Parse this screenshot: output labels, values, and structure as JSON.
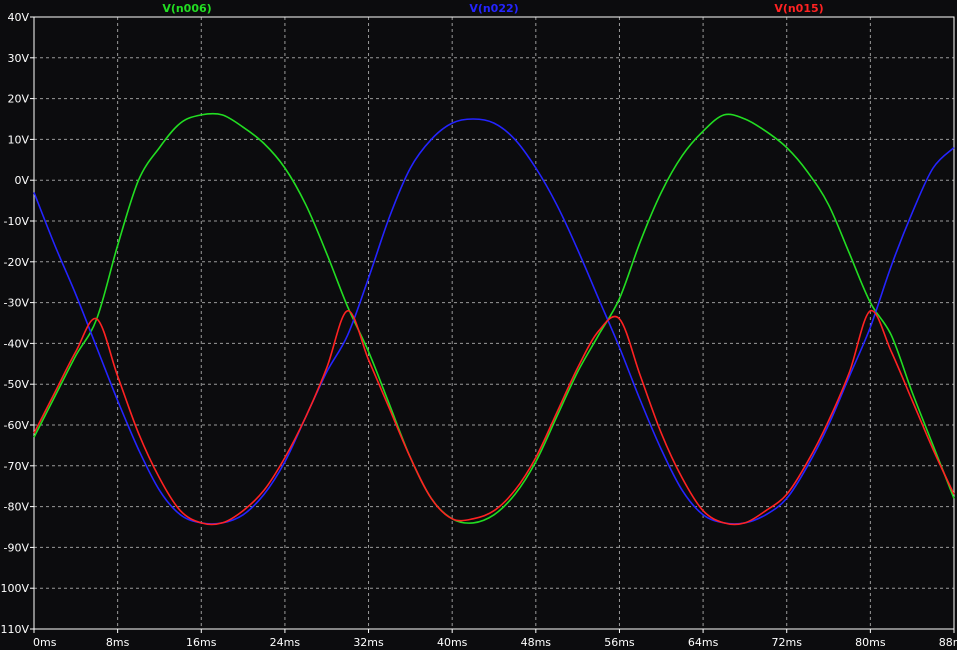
{
  "chart_data": {
    "type": "line",
    "xlabel": "",
    "ylabel": "",
    "xlim": [
      0,
      88
    ],
    "ylim": [
      -110,
      40
    ],
    "x_ticks": [
      "0ms",
      "8ms",
      "16ms",
      "24ms",
      "32ms",
      "40ms",
      "48ms",
      "56ms",
      "64ms",
      "72ms",
      "80ms",
      "88ms"
    ],
    "y_ticks": [
      "40V",
      "30V",
      "20V",
      "10V",
      "0V",
      "-10V",
      "-20V",
      "-30V",
      "-40V",
      "-50V",
      "-60V",
      "-70V",
      "-80V",
      "-90V",
      "-100V",
      "-110V"
    ],
    "grid": true,
    "legend_position": "top",
    "colors": {
      "background": "#0c0c0e",
      "grid": "#9a9a9a",
      "text": "#ffffff"
    },
    "series": [
      {
        "name": "V(n006)",
        "color": "#22dd22",
        "x": [
          0,
          2,
          4,
          6,
          8,
          10,
          12,
          14,
          16,
          18,
          20,
          22,
          24,
          26,
          28,
          30,
          32,
          34,
          36,
          38,
          40,
          42,
          44,
          46,
          48,
          50,
          52,
          54,
          56,
          58,
          60,
          62,
          64,
          66,
          68,
          70,
          72,
          74,
          76,
          78,
          80,
          82,
          84,
          86,
          88
        ],
        "y": [
          -63,
          -53,
          -43,
          -34,
          -16,
          0,
          8,
          14,
          16,
          16,
          13,
          9,
          3,
          -6,
          -18,
          -31,
          -42,
          -55,
          -68,
          -78,
          -83,
          -84,
          -82,
          -77,
          -69,
          -58,
          -47,
          -38,
          -29,
          -15,
          -3,
          6,
          12,
          16,
          15,
          12,
          8,
          2,
          -6,
          -18,
          -30,
          -38,
          -52,
          -65,
          -78
        ]
      },
      {
        "name": "V(n022)",
        "color": "#2424ff",
        "x": [
          0,
          2,
          4,
          6,
          8,
          10,
          12,
          14,
          16,
          18,
          20,
          22,
          24,
          26,
          28,
          30,
          32,
          34,
          36,
          38,
          40,
          42,
          44,
          46,
          48,
          50,
          52,
          54,
          56,
          58,
          60,
          62,
          64,
          66,
          68,
          70,
          72,
          74,
          76,
          78,
          80,
          82,
          84,
          86,
          88
        ],
        "y": [
          -3,
          -16,
          -28,
          -41,
          -54,
          -66,
          -76,
          -82,
          -84,
          -84,
          -82,
          -77,
          -69,
          -58,
          -47,
          -38,
          -24,
          -9,
          3,
          10,
          14,
          15,
          14,
          10,
          3,
          -6,
          -17,
          -29,
          -41,
          -54,
          -66,
          -76,
          -82,
          -84,
          -84,
          -82,
          -78,
          -70,
          -60,
          -48,
          -36,
          -21,
          -8,
          3,
          8
        ]
      },
      {
        "name": "V(n015)",
        "color": "#ff2222",
        "x": [
          0,
          2,
          4,
          6,
          8,
          10,
          12,
          14,
          16,
          18,
          20,
          22,
          24,
          26,
          28,
          30,
          32,
          34,
          36,
          38,
          40,
          42,
          44,
          46,
          48,
          50,
          52,
          54,
          56,
          58,
          60,
          62,
          64,
          66,
          68,
          70,
          72,
          74,
          76,
          78,
          80,
          82,
          84,
          86,
          88
        ],
        "y": [
          -62,
          -52,
          -42,
          -34,
          -48,
          -62,
          -73,
          -81,
          -84,
          -84,
          -81,
          -76,
          -68,
          -58,
          -46,
          -32,
          -44,
          -56,
          -68,
          -78,
          -83,
          -83,
          -81,
          -76,
          -68,
          -57,
          -46,
          -37,
          -34,
          -48,
          -62,
          -73,
          -81,
          -84,
          -84,
          -81,
          -77,
          -69,
          -59,
          -47,
          -32,
          -42,
          -54,
          -66,
          -77
        ]
      }
    ]
  }
}
